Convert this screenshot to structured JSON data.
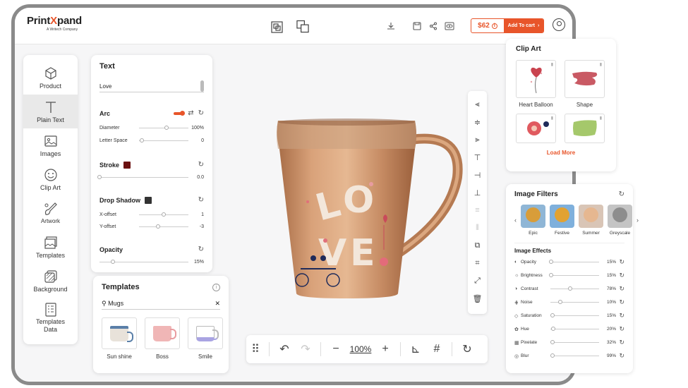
{
  "brand": {
    "name_part1": "Print",
    "name_x": "X",
    "name_part2": "pand",
    "tagline": "A Writech Company"
  },
  "topbar": {
    "price": "$62",
    "add_to_cart": "Add To cart"
  },
  "sidebar": {
    "items": [
      {
        "label": "Product",
        "icon": "cube-icon"
      },
      {
        "label": "Plain Text",
        "icon": "text-icon"
      },
      {
        "label": "Images",
        "icon": "image-icon"
      },
      {
        "label": "Clip Art",
        "icon": "smiley-icon"
      },
      {
        "label": "Artwork",
        "icon": "brush-icon"
      },
      {
        "label": "Templates",
        "icon": "templates-icon"
      },
      {
        "label": "Background",
        "icon": "background-icon"
      },
      {
        "label": "Templates Data",
        "icon": "data-icon"
      }
    ]
  },
  "text_panel": {
    "title": "Text",
    "value": "Love",
    "arc": {
      "label": "Arc",
      "diameter_label": "Diameter",
      "diameter_value": "100%",
      "diameter_level": 0.55,
      "letter_space_label": "Letter Space",
      "letter_space_value": "0",
      "letter_space_level": 0.05
    },
    "stroke": {
      "label": "Stroke",
      "color": "#6b1010",
      "value": "0.0",
      "level": 0.0
    },
    "drop_shadow": {
      "label": "Drop Shadow",
      "color": "#333333",
      "x_label": "X-offset",
      "x_value": "1",
      "x_level": 0.5,
      "y_label": "Y-offset",
      "y_value": "-3",
      "y_level": 0.38
    },
    "opacity": {
      "label": "Opacity",
      "value": "15%",
      "level": 0.15
    }
  },
  "templates_panel": {
    "title": "Templates",
    "search_value": "Mugs",
    "items": [
      {
        "label": "Sun shine",
        "color": "#e8e2da",
        "accent": "#5a7fa8"
      },
      {
        "label": "Boss",
        "color": "#f0b6b6",
        "accent": "#c0595d"
      },
      {
        "label": "Smile",
        "color": "#ffffff",
        "accent": "#a9a4e2"
      }
    ]
  },
  "mug": {
    "text": "LOVE",
    "body_color": "#c9906a"
  },
  "toolbar": {
    "zoom": "100%"
  },
  "clipart_panel": {
    "title": "Clip Art",
    "items": [
      {
        "label": "Heart Balloon"
      },
      {
        "label": "Shape"
      },
      {
        "label": ""
      },
      {
        "label": ""
      }
    ],
    "load_more": "Load More"
  },
  "filters_panel": {
    "title": "Image Filters",
    "filters": [
      {
        "label": "Epic",
        "color": "#d89d3a"
      },
      {
        "label": "Festive",
        "color": "#e2a232"
      },
      {
        "label": "Summer",
        "color": "#e6b790"
      },
      {
        "label": "Greyscale",
        "color": "#9a9a9a"
      }
    ],
    "effects_title": "Image Effects",
    "effects": [
      {
        "label": "Opacity",
        "value": "15%",
        "level": 0.02,
        "icon": "opacity-icon"
      },
      {
        "label": "Brightness",
        "value": "15%",
        "level": 0.02,
        "icon": "brightness-icon"
      },
      {
        "label": "Contrast",
        "value": "78%",
        "level": 0.4,
        "icon": "contrast-icon"
      },
      {
        "label": "Noise",
        "value": "10%",
        "level": 0.2,
        "icon": "noise-icon"
      },
      {
        "label": "Saturation",
        "value": "15%",
        "level": 0.05,
        "icon": "saturation-icon"
      },
      {
        "label": "Hue",
        "value": "20%",
        "level": 0.06,
        "icon": "hue-icon"
      },
      {
        "label": "Pixelate",
        "value": "32%",
        "level": 0.05,
        "icon": "pixelate-icon"
      },
      {
        "label": "Blur",
        "value": "99%",
        "level": 0.05,
        "icon": "blur-icon"
      }
    ]
  }
}
